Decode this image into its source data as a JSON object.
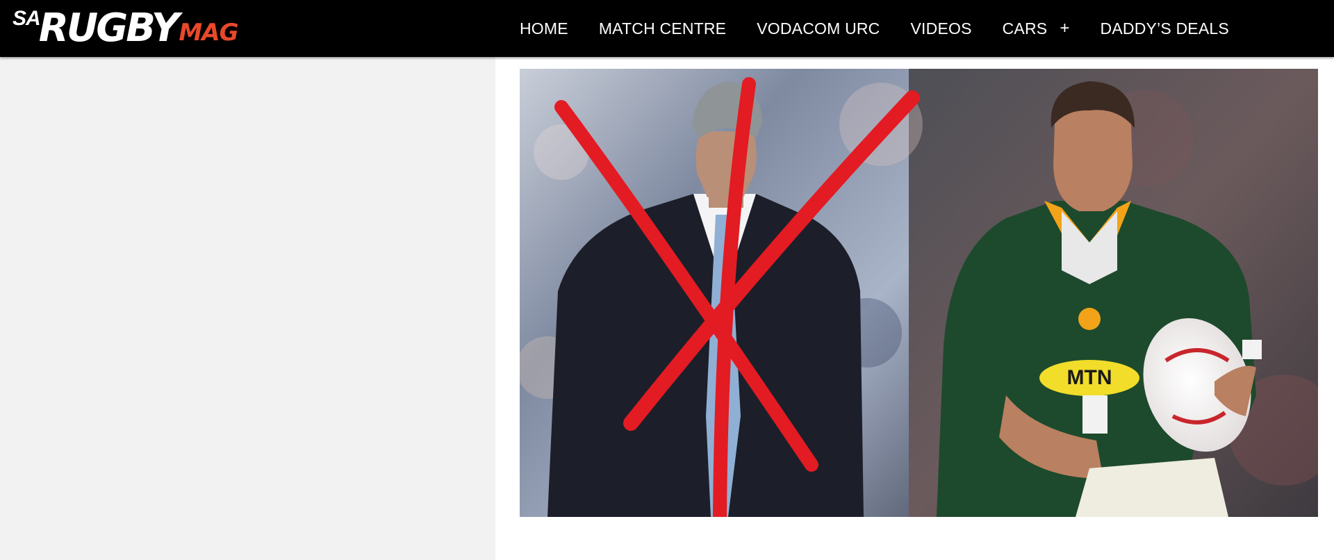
{
  "header": {
    "logo": {
      "sa": "SA",
      "rugby": "RUGBY",
      "mag": "MAG"
    },
    "nav": [
      {
        "label": "HOME"
      },
      {
        "label": "MATCH CENTRE"
      },
      {
        "label": "VODACOM URC"
      },
      {
        "label": "VIDEOS"
      },
      {
        "label": "CARS",
        "expand": "+"
      },
      {
        "label": "DADDY’S DEALS"
      }
    ]
  },
  "article": {
    "hero_image": {
      "jersey_sponsor": "MTN"
    }
  },
  "colors": {
    "header_bg": "#000000",
    "logo_accent": "#e8492a",
    "sidebar_bg": "#f2f2f2",
    "cross_red": "#e31b23",
    "jersey_green": "#1d4a2c",
    "collar_gold": "#f2a319"
  }
}
